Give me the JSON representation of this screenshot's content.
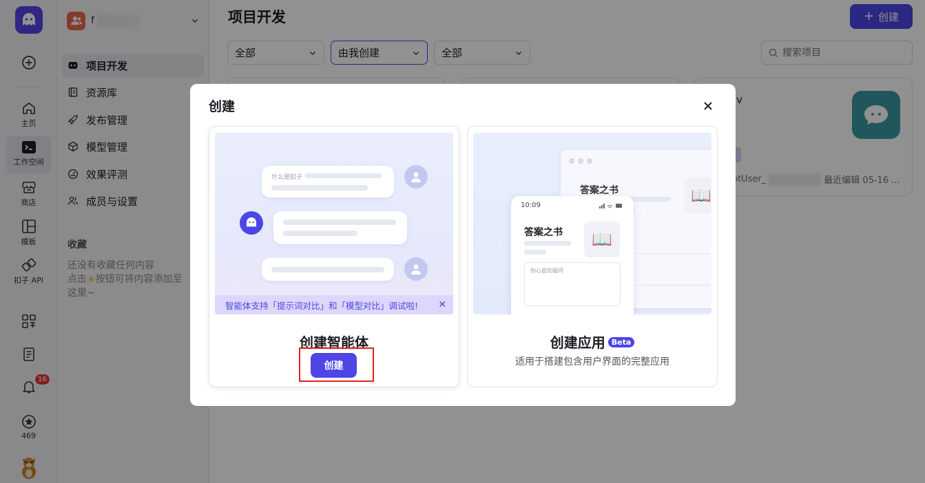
{
  "rail": {
    "items": [
      {
        "label": "主页",
        "icon": "home-icon"
      },
      {
        "label": "工作空间",
        "icon": "workspace-icon"
      },
      {
        "label": "商店",
        "icon": "store-icon"
      },
      {
        "label": "模板",
        "icon": "template-icon"
      },
      {
        "label": "扣子 API",
        "icon": "api-icon"
      }
    ],
    "notification_count": "16",
    "points": "469"
  },
  "sidebar": {
    "workspace_initial": "f",
    "nav": [
      {
        "label": "项目开发",
        "icon": "bot-icon"
      },
      {
        "label": "资源库",
        "icon": "library-icon"
      },
      {
        "label": "发布管理",
        "icon": "rocket-icon"
      },
      {
        "label": "模型管理",
        "icon": "cube-icon"
      },
      {
        "label": "效果评测",
        "icon": "gauge-icon"
      },
      {
        "label": "成员与设置",
        "icon": "members-icon"
      }
    ],
    "favorites_title": "收藏",
    "favorites_empty_line1": "还没有收藏任何内容",
    "favorites_empty_line2_a": "点击",
    "favorites_empty_line2_b": "按钮可将内容添加至",
    "favorites_empty_line3": "这里~"
  },
  "main": {
    "title": "项目开发",
    "create_label": "创建",
    "filters": [
      "全部",
      "由我创建",
      "全部"
    ],
    "search_placeholder": "搜索项目",
    "card": {
      "title_tail": "lv",
      "owner_prefix": "otUser_",
      "edited": "最近编辑 05-16 ..."
    }
  },
  "modal": {
    "title": "创建",
    "agent": {
      "bubble_question": "什么是扣子",
      "tip": "智能体支持「提示词对比」和「模型对比」调试啦!",
      "title": "创建智能体",
      "button": "创建"
    },
    "app": {
      "phone_time": "10:09",
      "book_title": "答案之书",
      "input_placeholder": "你心底的疑问",
      "title": "创建应用",
      "beta": "Beta",
      "desc": "适用于搭建包含用户界面的完整应用"
    }
  }
}
